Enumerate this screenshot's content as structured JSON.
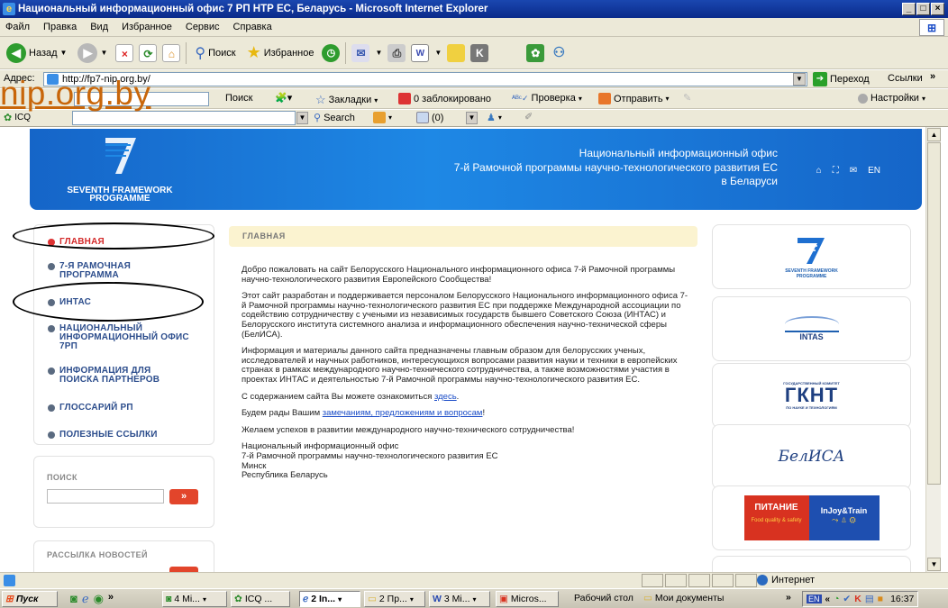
{
  "window": {
    "title": "Национальный информационный офис 7 РП НТР ЕС, Беларусь - Microsoft Internet Explorer"
  },
  "menu": [
    "Файл",
    "Правка",
    "Вид",
    "Избранное",
    "Сервис",
    "Справка"
  ],
  "toolbar": {
    "back": "Назад",
    "search": "Поиск",
    "favorites": "Избранное"
  },
  "address": {
    "label": "Адрес:",
    "url": "http://fp7-nip.org.by/",
    "go": "Переход",
    "links": "Ссылки"
  },
  "toolbar2": {
    "search": "Поиск",
    "bookmarks": "Закладки",
    "blocked": "0 заблокировано",
    "check": "Проверка",
    "send": "Отправить",
    "settings": "Настройки"
  },
  "toolbar3": {
    "icq": "ICQ",
    "search": "Search",
    "counter": "(0)"
  },
  "overlay_url": "nip.org.by",
  "banner": {
    "logo_text": "SEVENTH FRAMEWORK PROGRAMME",
    "title_line1": "Национальный информационный офис",
    "title_line2": "7-й Рамочной программы научно-технологического развития ЕС",
    "title_line3": "в Беларуси",
    "lang": "EN"
  },
  "nav": [
    "ГЛАВНАЯ",
    "7-Я РАМОЧНАЯ ПРОГРАММА",
    "ИНТАС",
    "НАЦИОНАЛЬНЫЙ ИНФОРМАЦИОННЫЙ ОФИС 7РП",
    "ИНФОРМАЦИЯ ДЛЯ ПОИСКА ПАРТНЕРОВ",
    "ГЛОССАРИЙ РП",
    "ПОЛЕЗНЫЕ ССЫЛКИ"
  ],
  "search": {
    "label": "ПОИСК",
    "button": "»"
  },
  "newsletter": {
    "label": "РАССЫЛКА НОВОСТЕЙ"
  },
  "main": {
    "header": "ГЛАВНАЯ",
    "p1": "Добро пожаловать на сайт Белорусского Национального информационного офиса 7-й Рамочной программы научно-технологического развития Европейского Сообщества!",
    "p2": "Этот сайт разработан и поддерживается персоналом Белорусского Национального информационного офиса 7-й Рамочной программы научно-технологического развития ЕС при поддержке Международной ассоциации по содействию сотрудничеству с учеными из независимых государств бывшего Советского Союза (ИНТАС) и Белорусского института системного анализа и информационного обеспечения научно-технической сферы (БелИСА).",
    "p3": "Информация и материалы данного сайта предназначены главным образом для белорусских ученых, исследователей и научных работников, интересующихся вопросами развития науки и техники в европейских странах в рамках международного научно-технического сотрудничества, а также возможностями участия в проектах ИНТАС и деятельностью 7-й Рамочной программы научно-технологического развития ЕС.",
    "p4_pre": "С содержанием сайта Вы можете ознакомиться ",
    "p4_link": "здесь",
    "p4_post": ".",
    "p5_pre": "Будем рады Вашим ",
    "p5_link": "замечаниям, предложениям и вопросам",
    "p5_post": "!",
    "p6": "Желаем успехов в развитии международного научно-технического сотрудничества!",
    "sig1": "Национальный информационный офис",
    "sig2": "7-й Рамочной программы научно-технологического развития ЕС",
    "sig3": "Минск",
    "sig4": "Республика Беларусь"
  },
  "partners": {
    "fp7": "SEVENTH FRAMEWORK PROGRAMME",
    "intas": "INTAS",
    "gknt_top": "ГОСУДАРСТВЕННЫЙ КОМИТЕТ",
    "gknt": "ГКНТ",
    "gknt_bottom": "ПО НАУКЕ И ТЕХНОЛОГИЯМ",
    "belisa": "БелИСА",
    "pitanie": "ПИТАНИЕ",
    "pitanie_sub": "Food quality & safety",
    "injoy": "InJoy&Train"
  },
  "status": {
    "zone": "Интернет"
  },
  "taskbar": {
    "start": "Пуск",
    "tasks": [
      "4 Mi...",
      "ICQ ...",
      "2 In...",
      "2 Пр...",
      "3 Mi...",
      "Micros..."
    ],
    "desktop": "Рабочий стол",
    "mydocs": "Мои документы",
    "lang": "EN",
    "clock": "16:37"
  }
}
